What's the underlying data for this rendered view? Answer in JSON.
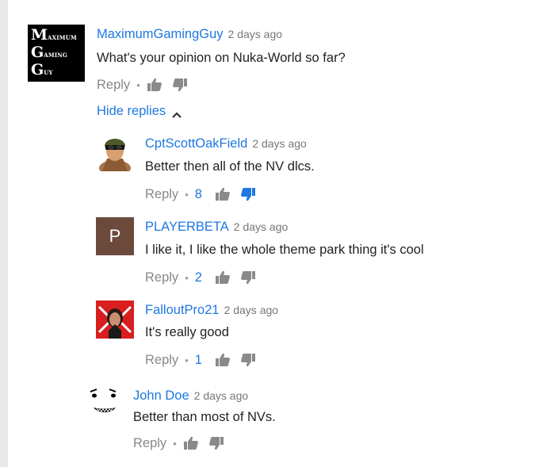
{
  "comment": {
    "author": "MaximumGamingGuy",
    "time": "2 days ago",
    "text": "What's your opinion on Nuka-World so far?",
    "reply_label": "Reply",
    "avatar_lines": [
      {
        "big": "M",
        "small": "AXIMUM"
      },
      {
        "big": "G",
        "small": "AMING"
      },
      {
        "big": "G",
        "small": "UY"
      }
    ]
  },
  "hide_replies_label": "Hide replies",
  "replies": [
    {
      "author": "CptScottOakField",
      "time": "2 days ago",
      "text": "Better then all of the NV dlcs.",
      "reply_label": "Reply",
      "likes": "8",
      "disliked": true
    },
    {
      "author": "PLAYERBETA",
      "time": "2 days ago",
      "text": "I like it, I like the whole theme park thing it's cool",
      "reply_label": "Reply",
      "likes": "2",
      "avatar_letter": "P"
    },
    {
      "author": "FalloutPro21",
      "time": "2 days ago",
      "text": "It's really good",
      "reply_label": "Reply",
      "likes": "1"
    },
    {
      "author": "John Doe",
      "time": "2 days ago",
      "text": "Better than most of NVs.",
      "reply_label": "Reply"
    }
  ],
  "colors": {
    "link": "#1e78e0",
    "muted": "#888888",
    "playerbeta_avatar": "#6b4a3c"
  }
}
